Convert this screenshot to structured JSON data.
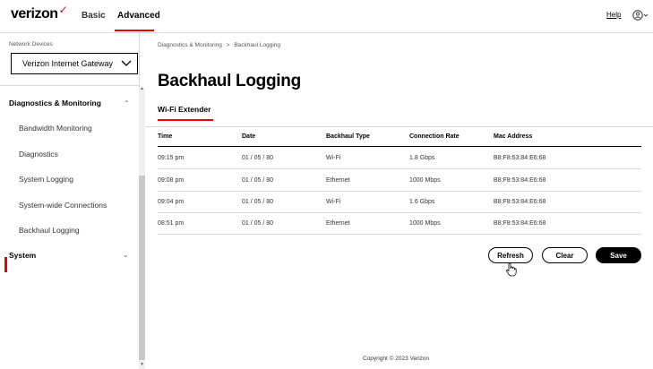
{
  "header": {
    "logo": "verizon",
    "tabs": [
      {
        "label": "Basic"
      },
      {
        "label": "Advanced"
      }
    ],
    "help_label": "Help",
    "user_icon": "user-icon",
    "accent_color": "#ee0000"
  },
  "sidebar": {
    "device_label": "Network Devices",
    "device_select_value": "Verizon Internet Gateway",
    "sections": [
      {
        "label": "Diagnostics & Monitoring",
        "expanded": true,
        "items": [
          {
            "label": "Bandwidth Monitoring"
          },
          {
            "label": "Diagnostics"
          },
          {
            "label": "System Logging"
          },
          {
            "label": "System-wide Connections"
          },
          {
            "label": "Backhaul Logging",
            "active": true
          }
        ]
      },
      {
        "label": "System",
        "expanded": false
      }
    ]
  },
  "main": {
    "breadcrumb": [
      "Diagnostics & Monitoring",
      "Backhaul Logging"
    ],
    "breadcrumb_sep": ">",
    "title": "Backhaul Logging",
    "subtab": "Wi-Fi Extender",
    "table": {
      "columns": [
        "Time",
        "Date",
        "Backhaul Type",
        "Connection Rate",
        "Mac Address"
      ],
      "rows": [
        [
          "09:15 pm",
          "01 / 05 / 80",
          "Wi-Fi",
          "1.8 Gbps",
          "B8:F8:53:84:E6:68"
        ],
        [
          "09:08 pm",
          "01 / 05 / 80",
          "Ethernet",
          "1000 Mbps",
          "B8:F8:53:84:E6:68"
        ],
        [
          "09:04 pm",
          "01 / 05 / 80",
          "Wi-Fi",
          "1.6 Gbps",
          "B8:F8:53:84:E6:68"
        ],
        [
          "08:51 pm",
          "01 / 05 / 80",
          "Ethernet",
          "1000 Mbps",
          "B8:F8:53:84:E6:68"
        ]
      ]
    },
    "buttons": {
      "refresh": "Refresh",
      "clear": "Clear",
      "save": "Save"
    }
  },
  "footer": {
    "copyright": "Copyright © 2023 Verizon"
  }
}
